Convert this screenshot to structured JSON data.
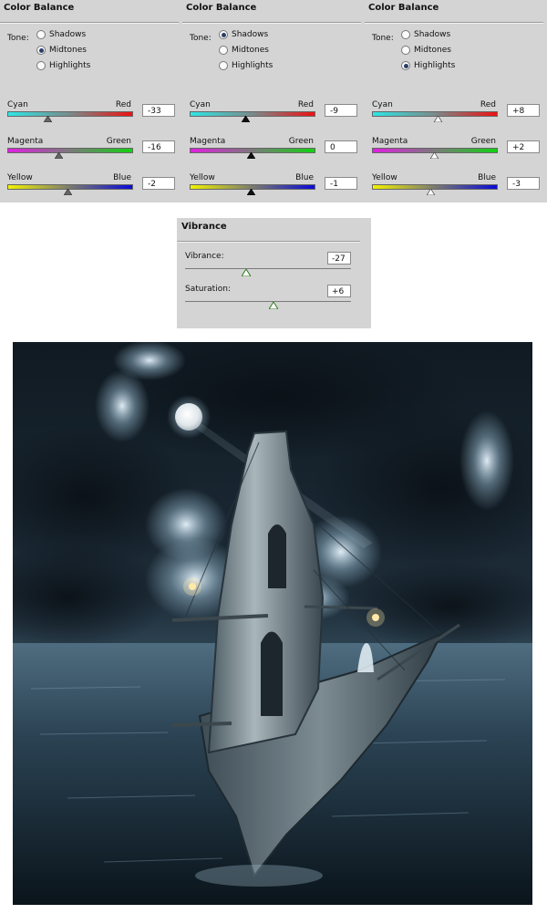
{
  "color_balance_panels": [
    {
      "title": "Color Balance",
      "tone_label": "Tone:",
      "tones": [
        "Shadows",
        "Midtones",
        "Highlights"
      ],
      "selected_tone": "Midtones",
      "sliders": [
        {
          "left": "Cyan",
          "right": "Red",
          "value": "-33"
        },
        {
          "left": "Magenta",
          "right": "Green",
          "value": "-16"
        },
        {
          "left": "Yellow",
          "right": "Blue",
          "value": "-2"
        }
      ]
    },
    {
      "title": "Color Balance",
      "tone_label": "Tone:",
      "tones": [
        "Shadows",
        "Midtones",
        "Highlights"
      ],
      "selected_tone": "Shadows",
      "sliders": [
        {
          "left": "Cyan",
          "right": "Red",
          "value": "-9"
        },
        {
          "left": "Magenta",
          "right": "Green",
          "value": "0"
        },
        {
          "left": "Yellow",
          "right": "Blue",
          "value": "-1"
        }
      ]
    },
    {
      "title": "Color Balance",
      "tone_label": "Tone:",
      "tones": [
        "Shadows",
        "Midtones",
        "Highlights"
      ],
      "selected_tone": "Highlights",
      "sliders": [
        {
          "left": "Cyan",
          "right": "Red",
          "value": "+8"
        },
        {
          "left": "Magenta",
          "right": "Green",
          "value": "+2"
        },
        {
          "left": "Yellow",
          "right": "Blue",
          "value": "-3"
        }
      ]
    }
  ],
  "vibrance_panel": {
    "title": "Vibrance",
    "vibrance": {
      "label": "Vibrance:",
      "value": "-27"
    },
    "saturation": {
      "label": "Saturation:",
      "value": "+6"
    }
  },
  "colors": {
    "panel_bg": "#d4d4d4",
    "cyan_red": [
      "#2ee6e6",
      "#ee1111"
    ],
    "magenta_green": [
      "#e020e0",
      "#12d212"
    ],
    "yellow_blue": [
      "#f2f200",
      "#0a0ad8"
    ],
    "radio_selected": "#2b3f66"
  }
}
